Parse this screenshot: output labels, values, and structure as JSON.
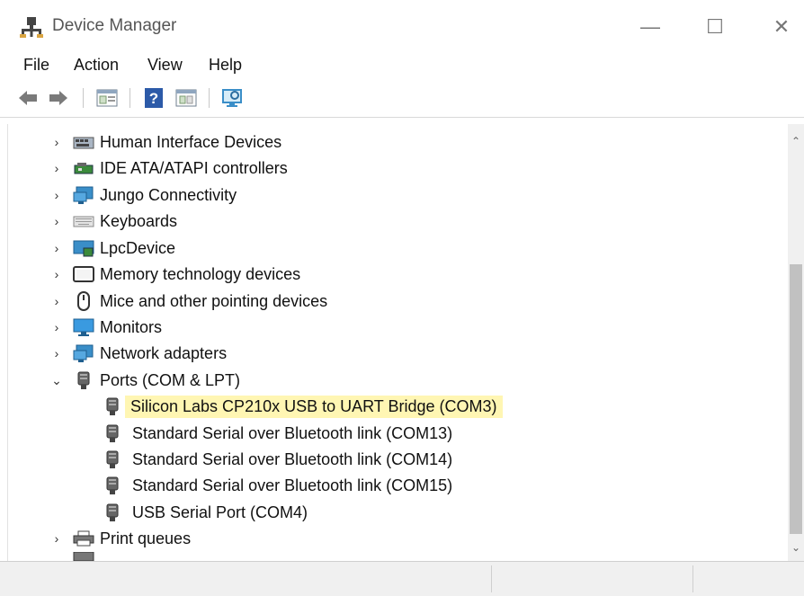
{
  "window": {
    "title": "Device Manager",
    "controls": {
      "minimize": "—",
      "maximize": "☐",
      "close": "✕"
    }
  },
  "menu": [
    "File",
    "Action",
    "View",
    "Help"
  ],
  "toolbar": {
    "icons": [
      "back-arrow-icon",
      "forward-arrow-icon",
      "properties-icon",
      "help-icon",
      "update-driver-icon",
      "scan-hardware-icon"
    ]
  },
  "tree": {
    "items": [
      {
        "label": "Human Interface Devices",
        "expanded": false,
        "icon": "hid-icon"
      },
      {
        "label": "IDE ATA/ATAPI controllers",
        "expanded": false,
        "icon": "ide-controller-icon"
      },
      {
        "label": "Jungo Connectivity",
        "expanded": false,
        "icon": "network-monitor-icon"
      },
      {
        "label": "Keyboards",
        "expanded": false,
        "icon": "keyboard-icon"
      },
      {
        "label": "LpcDevice",
        "expanded": false,
        "icon": "lpc-device-icon"
      },
      {
        "label": "Memory technology devices",
        "expanded": false,
        "icon": "memory-device-icon"
      },
      {
        "label": "Mice and other pointing devices",
        "expanded": false,
        "icon": "mouse-icon"
      },
      {
        "label": "Monitors",
        "expanded": false,
        "icon": "monitor-icon"
      },
      {
        "label": "Network adapters",
        "expanded": false,
        "icon": "network-adapter-icon"
      },
      {
        "label": "Ports (COM & LPT)",
        "expanded": true,
        "icon": "port-icon"
      }
    ],
    "ports_children": [
      {
        "label": "Silicon Labs CP210x USB to UART Bridge (COM3)",
        "highlighted": true
      },
      {
        "label": "Standard Serial over Bluetooth link (COM13)"
      },
      {
        "label": "Standard Serial over Bluetooth link (COM14)"
      },
      {
        "label": "Standard Serial over Bluetooth link (COM15)"
      },
      {
        "label": "USB Serial Port (COM4)"
      }
    ],
    "after": [
      {
        "label": "Print queues",
        "expanded": false,
        "icon": "printer-icon"
      }
    ],
    "highlight_color": "#fff6b3"
  }
}
